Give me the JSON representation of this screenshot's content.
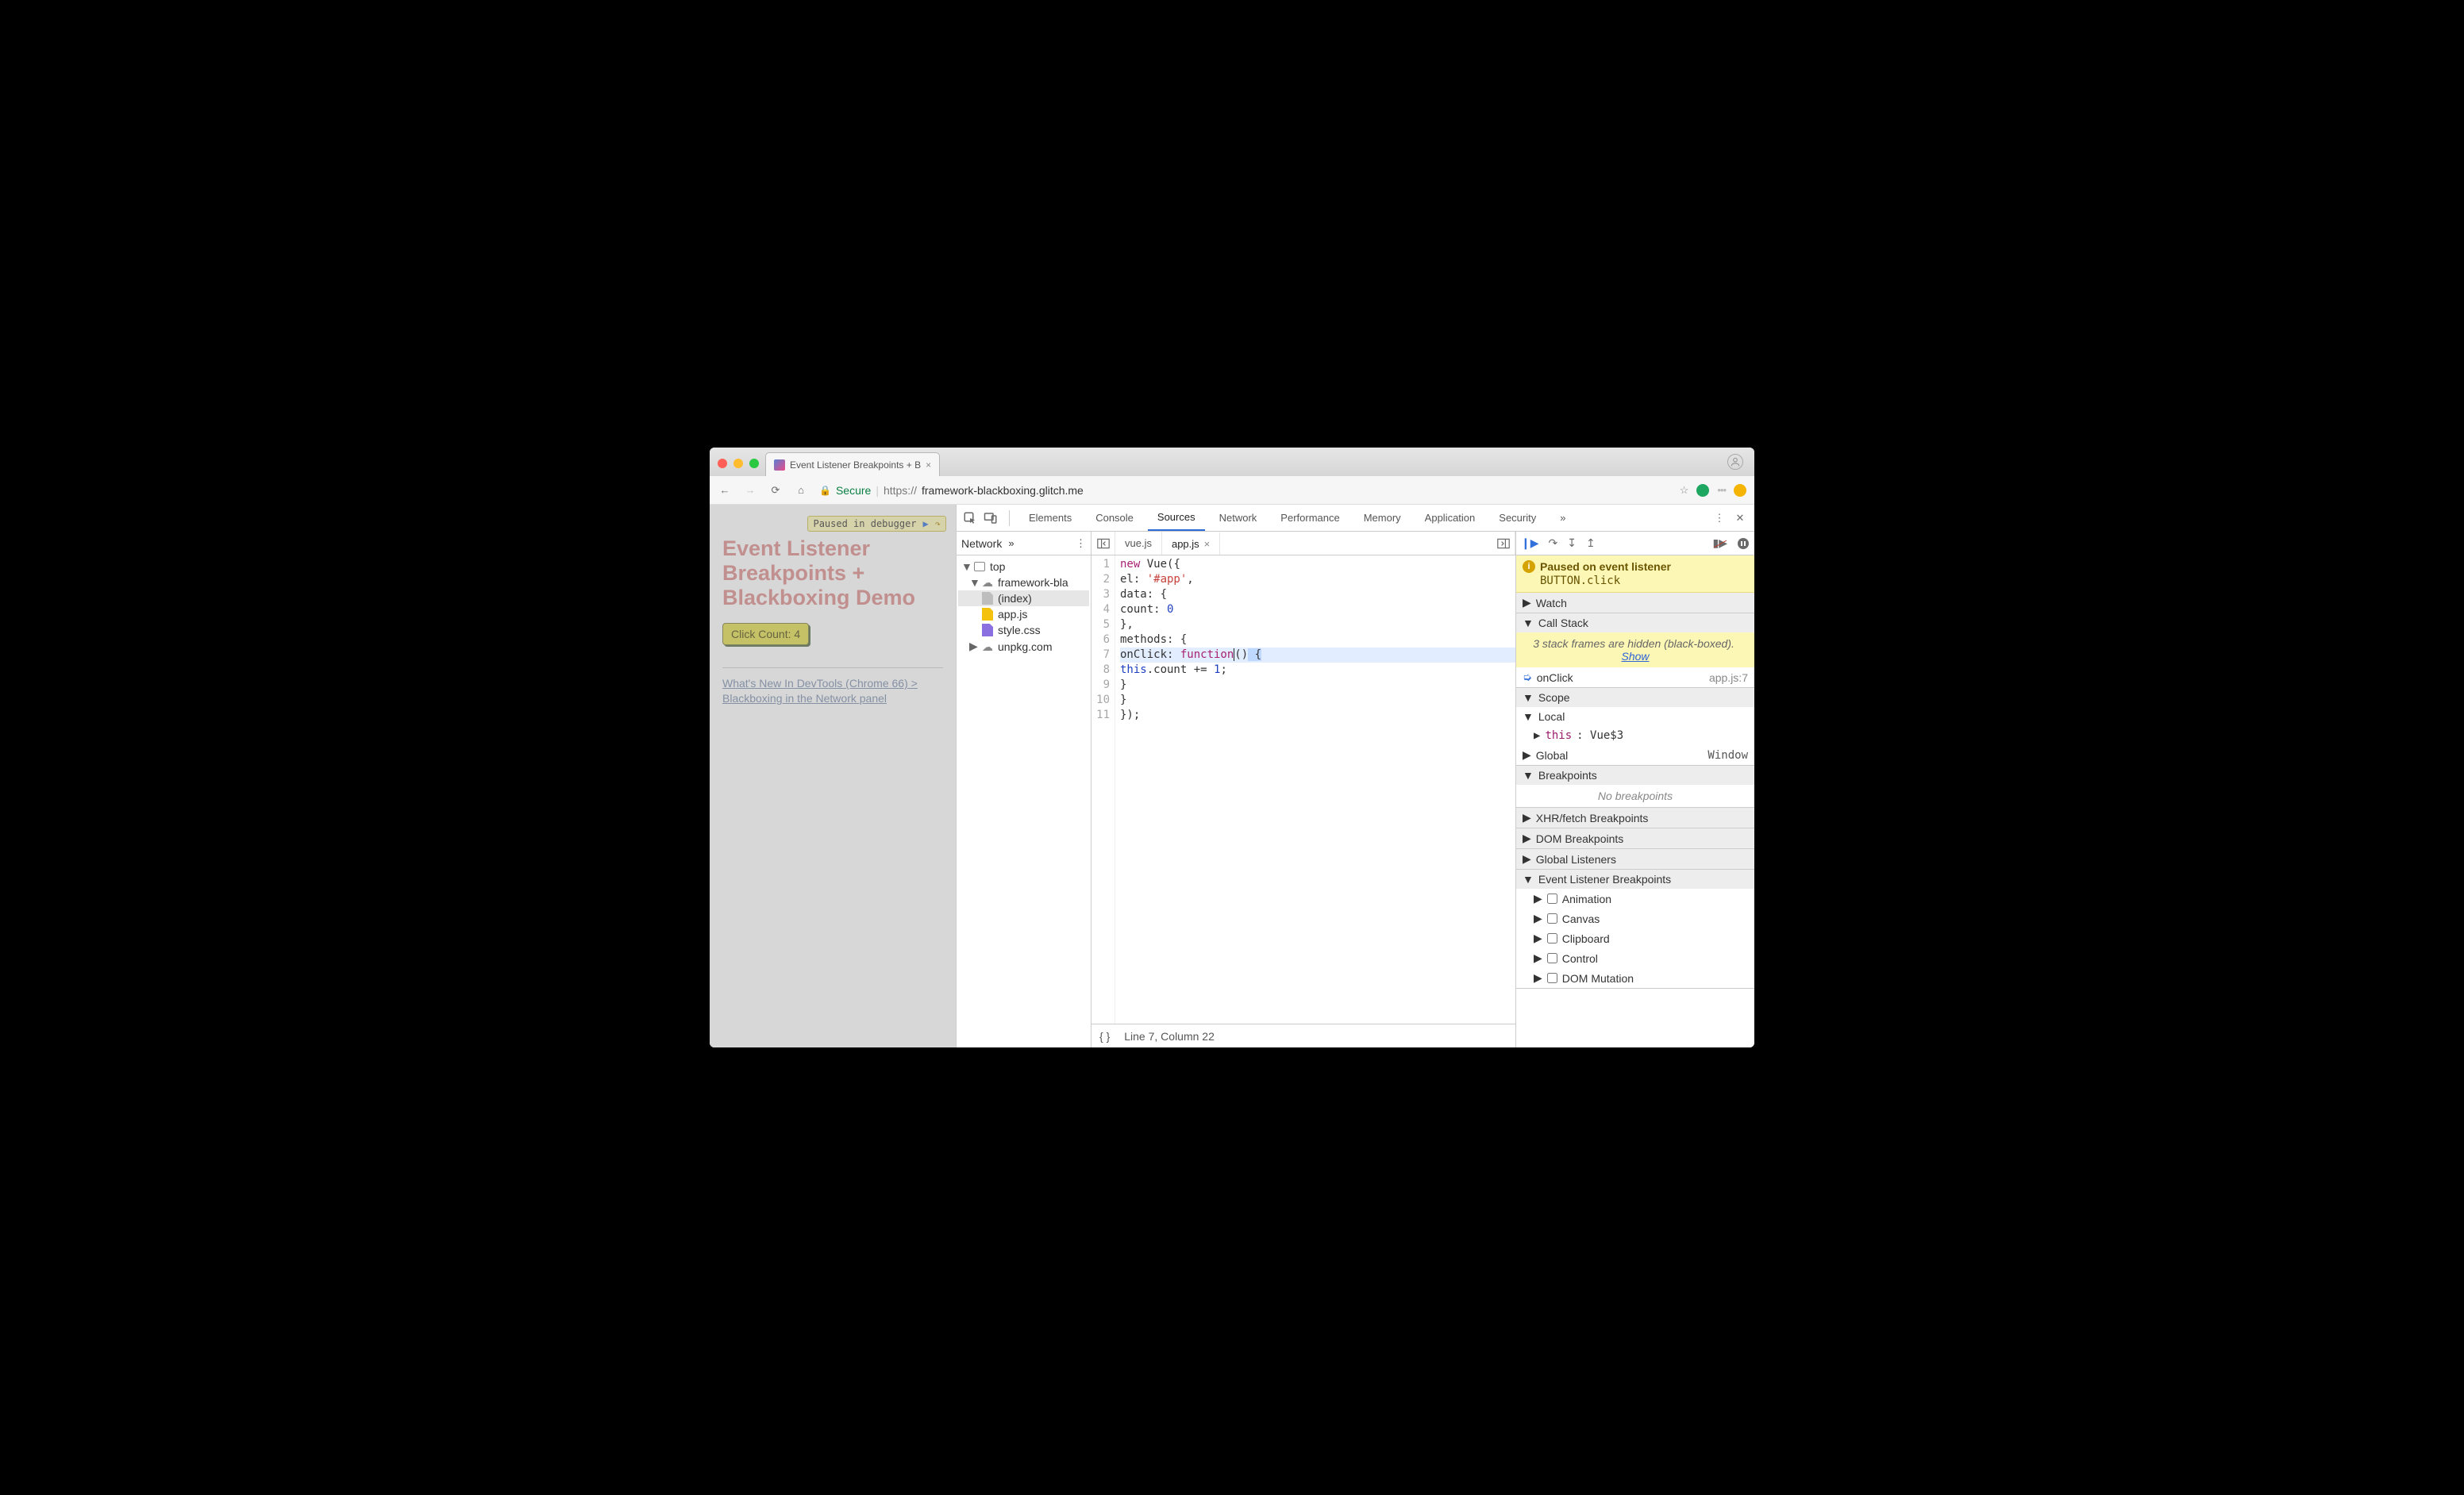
{
  "browser": {
    "tab_title": "Event Listener Breakpoints + B",
    "secure_label": "Secure",
    "url_scheme": "https://",
    "url_host": "framework-blackboxing.glitch.me",
    "profile_initial": "•"
  },
  "page": {
    "paused_label": "Paused in debugger",
    "heading_l1": "Event Listener",
    "heading_l2": "Breakpoints +",
    "heading_l3": "Blackboxing Demo",
    "button_label": "Click Count: 4",
    "link_text": "What's New In DevTools (Chrome 66) > Blackboxing in the Network panel"
  },
  "devtools": {
    "tabs": [
      "Elements",
      "Console",
      "Sources",
      "Network",
      "Performance",
      "Memory",
      "Application",
      "Security"
    ],
    "active_tab": "Sources",
    "more_glyph": "»",
    "menu_glyph": "⋮",
    "close_glyph": "✕"
  },
  "navigator": {
    "panel_label": "Network",
    "tree": {
      "top": "top",
      "origin1": "framework-bla",
      "files": [
        "(index)",
        "app.js",
        "style.css"
      ],
      "origin2": "unpkg.com"
    }
  },
  "editor": {
    "tabs": [
      "vue.js",
      "app.js"
    ],
    "active_tab": "app.js",
    "line_count": 11,
    "status": "Line 7, Column 22",
    "format_glyph": "{ }",
    "code": {
      "l1a": "new",
      "l1b": " Vue({",
      "l2a": "  el: ",
      "l2b": "'#app'",
      "l2c": ",",
      "l3": "  data: {",
      "l4a": "    count: ",
      "l4b": "0",
      "l5": "  },",
      "l6": "  methods: {",
      "l7a": "    onClick: ",
      "l7b": "function",
      "l7c": "()",
      " l7d": " {",
      "l8a": "      ",
      "l8b": "this",
      "l8c": ".count += ",
      "l8d": "1",
      "l8e": ";",
      "l9": "    }",
      "l10": "  }",
      "l11": "});"
    }
  },
  "debugger": {
    "paused_title": "Paused on event listener",
    "paused_detail": "BUTTON.click",
    "sections": {
      "watch": "Watch",
      "callstack": "Call Stack",
      "bb_msg_a": "3 stack frames are hidden (black-boxed).",
      "bb_show": "Show",
      "frame": "onClick",
      "frame_loc": "app.js:7",
      "scope": "Scope",
      "local": "Local",
      "this_label": "this",
      "this_val": ": Vue$3",
      "global": "Global",
      "global_val": "Window",
      "breakpoints": "Breakpoints",
      "no_bp": "No breakpoints",
      "xhr": "XHR/fetch Breakpoints",
      "dom": "DOM Breakpoints",
      "glisten": "Global Listeners",
      "elb": "Event Listener Breakpoints",
      "cats": [
        "Animation",
        "Canvas",
        "Clipboard",
        "Control",
        "DOM Mutation"
      ]
    }
  }
}
